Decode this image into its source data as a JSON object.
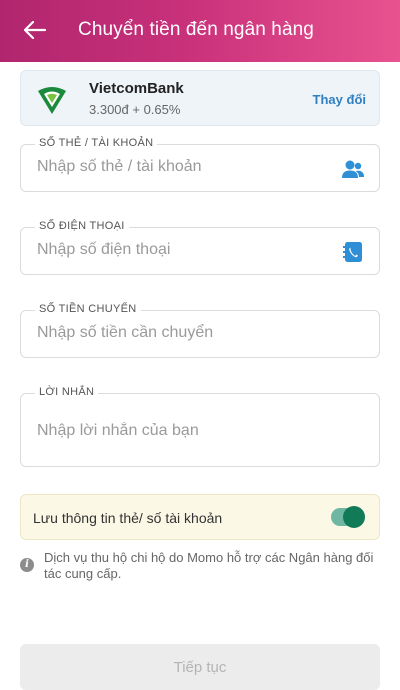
{
  "header": {
    "title": "Chuyển tiền đến ngân hàng",
    "back_icon": "arrow-left-icon",
    "colors": [
      "#b0266e",
      "#e8528f"
    ]
  },
  "bank": {
    "name": "VietcomBank",
    "fee": "3.300đ + 0.65%",
    "change_label": "Thay đổi",
    "logo_icon": "vietcombank-logo-icon"
  },
  "fields": {
    "account": {
      "label": "SỐ THẺ / TÀI KHOẢN",
      "placeholder": "Nhập số thẻ / tài khoản",
      "icon": "contacts-icon"
    },
    "phone": {
      "label": "SỐ ĐIỆN THOẠI",
      "placeholder": "Nhập số điện thoại",
      "icon": "phonebook-icon"
    },
    "amount": {
      "label": "SỐ TIỀN CHUYỂN",
      "placeholder": "Nhập số tiền cần chuyển"
    },
    "message": {
      "label": "LỜI NHẮN",
      "placeholder": "Nhập lời nhắn của bạn"
    }
  },
  "save": {
    "label": "Lưu thông tin thẻ/ số tài khoản",
    "enabled": true,
    "accent": "#117a57"
  },
  "info": {
    "icon": "info-icon",
    "text": "Dịch vụ thu hộ chi hộ do Momo hỗ trợ các Ngân hàng đối tác cung cấp."
  },
  "footer": {
    "continue_label": "Tiếp tục"
  }
}
